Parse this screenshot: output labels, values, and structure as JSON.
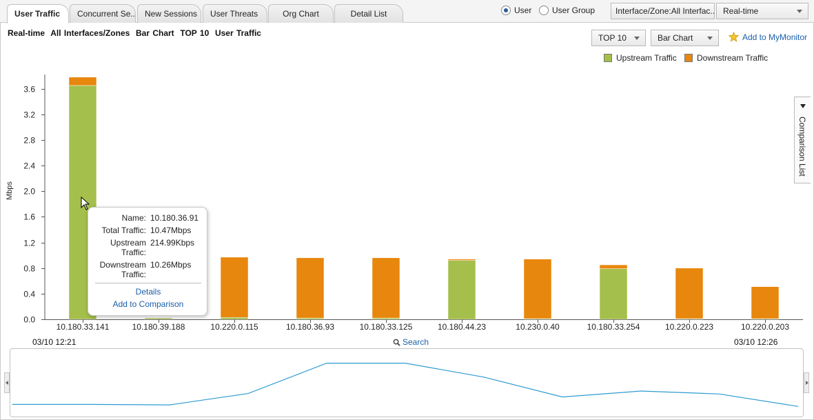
{
  "tabs": [
    {
      "label": "User Traffic",
      "active": true
    },
    {
      "label": "Concurrent Se...",
      "active": false
    },
    {
      "label": "New Sessions",
      "active": false
    },
    {
      "label": "User Threats",
      "active": false
    },
    {
      "label": "Org Chart",
      "active": false
    },
    {
      "label": "Detail List",
      "active": false
    }
  ],
  "view_mode": {
    "user_label": "User",
    "user_group_label": "User Group",
    "selected": "User"
  },
  "interface_select": {
    "value": "Interface/Zone:All Interfac..."
  },
  "time_select": {
    "value": "Real-time"
  },
  "subtitle": {
    "mode": "Real-time",
    "scope": "All Interfaces/Zones",
    "chart_type": "Bar Chart",
    "top": "TOP 10",
    "metric": "User Traffic"
  },
  "top_select": {
    "value": "TOP 10"
  },
  "chart_select": {
    "value": "Bar Chart"
  },
  "add_monitor": {
    "label": "Add to MyMonitor",
    "icon": "star-icon"
  },
  "comparison_list": {
    "label": "Comparison List"
  },
  "colors": {
    "upstream": "#a5bf4c",
    "downstream": "#e8870d",
    "line": "#2d9bd2"
  },
  "chart_data": {
    "type": "bar",
    "stacked": true,
    "ylabel": "Mbps",
    "ylim": [
      0,
      3.8
    ],
    "yticks": [
      0.0,
      0.4,
      0.8,
      1.2,
      1.6,
      2.0,
      2.4,
      2.8,
      3.2,
      3.6
    ],
    "ytick_labels": [
      "0.0",
      "0.4",
      "0.8",
      "1.2",
      "1.6",
      "2.0",
      "2.4",
      "2.8",
      "3.2",
      "3.6"
    ],
    "grid": false,
    "legend": "top-right",
    "categories": [
      "10.180.33.141",
      "10.180.39.188",
      "10.220.0.115",
      "10.180.36.93",
      "10.180.33.125",
      "10.180.44.23",
      "10.230.0.40",
      "10.180.33.254",
      "10.220.0.223",
      "10.220.0.203"
    ],
    "series": [
      {
        "name": "Upstream Traffic",
        "values": [
          3.65,
          0.02,
          0.03,
          0.02,
          0.02,
          0.92,
          0.01,
          0.79,
          0.01,
          0.01
        ]
      },
      {
        "name": "Downstream Traffic",
        "values": [
          0.13,
          0.0,
          0.94,
          0.94,
          0.94,
          0.02,
          0.93,
          0.06,
          0.79,
          0.5
        ]
      }
    ]
  },
  "tooltip": {
    "name_key": "Name:",
    "name_val": "10.180.36.91",
    "total_key": "Total Traffic:",
    "total_val": "10.47Mbps",
    "up_key": "Upstream Traffic:",
    "up_val": "214.99Kbps",
    "down_key": "Downstream Traffic:",
    "down_val": "10.26Mbps",
    "details": "Details",
    "add_comparison": "Add to Comparison"
  },
  "timeline": {
    "start": "03/10 12:21",
    "end": "03/10 12:26",
    "search_label": "Search",
    "trend": [
      0.05,
      0.05,
      0.04,
      0.27,
      0.88,
      0.88,
      0.6,
      0.2,
      0.32,
      0.26,
      0.01
    ]
  }
}
